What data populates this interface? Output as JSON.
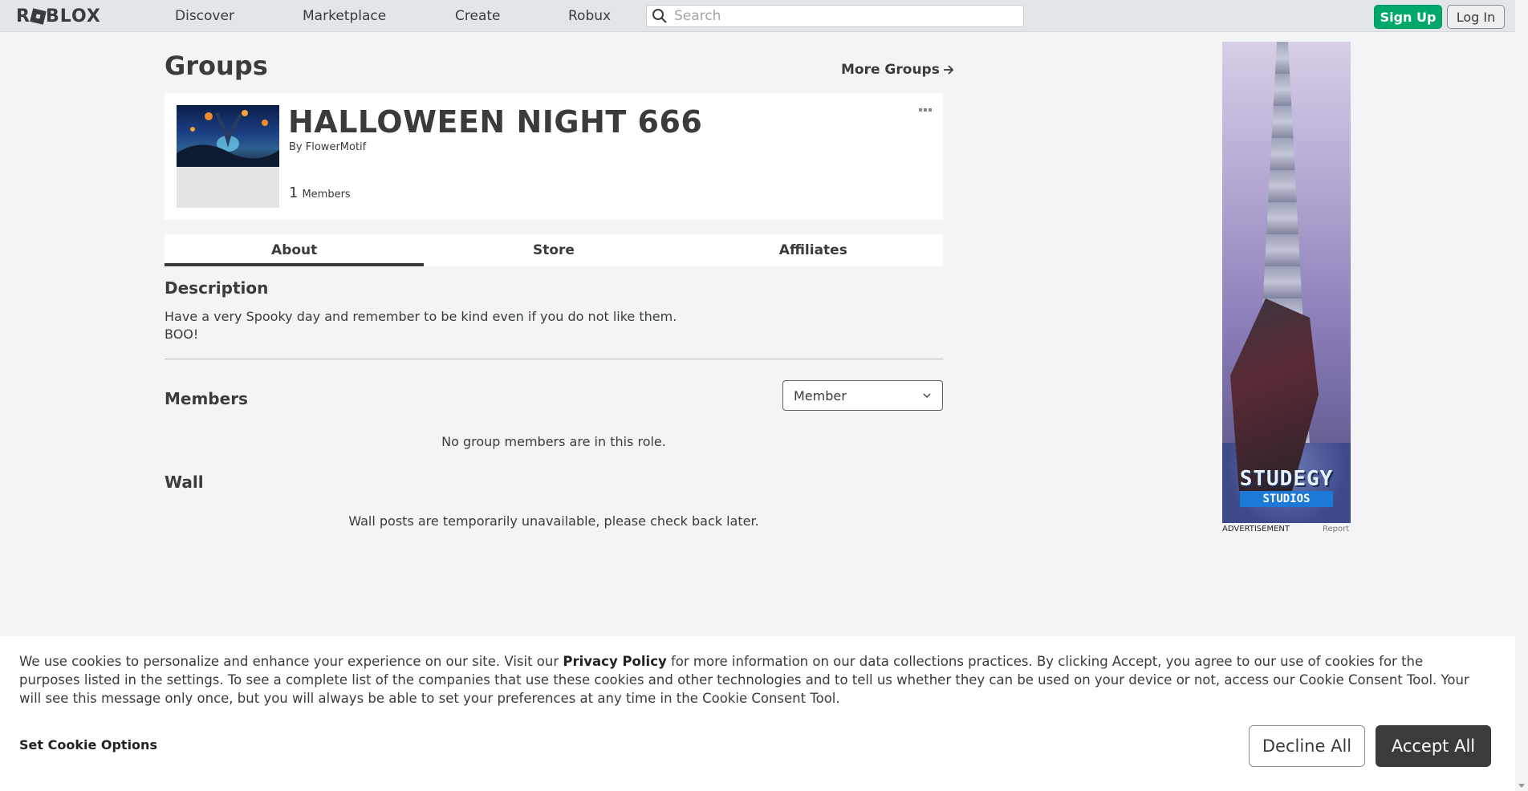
{
  "nav": {
    "logo": "ROBLOX",
    "links": [
      "Discover",
      "Marketplace",
      "Create",
      "Robux"
    ],
    "search_placeholder": "Search",
    "sign_up": "Sign Up",
    "log_in": "Log In"
  },
  "page": {
    "title": "Groups",
    "more_groups": "More Groups"
  },
  "group": {
    "name": "HALLOWEEN NIGHT 666",
    "by_label": "By",
    "owner": "FlowerMotif",
    "member_count": "1",
    "members_label": "Members"
  },
  "tabs": [
    "About",
    "Store",
    "Affiliates"
  ],
  "about": {
    "description_heading": "Description",
    "description": "Have a very Spooky day and remember to be kind even if you do not like them.\nBOO!",
    "members_heading": "Members",
    "role_selected": "Member",
    "members_empty": "No group members are in this role.",
    "wall_heading": "Wall",
    "wall_unavailable": "Wall posts are temporarily unavailable, please check back later."
  },
  "ad": {
    "brand_line1": "STUDEGY",
    "brand_line2": "STUDIOS",
    "label": "ADVERTISEMENT",
    "report": "Report"
  },
  "cookie": {
    "text_before": "We use cookies to personalize and enhance your experience on our site. Visit our ",
    "privacy_link": "Privacy Policy",
    "text_after": " for more information on our data collections practices. By clicking Accept, you agree to our use of cookies for the purposes listed in the settings. To see a complete list of the companies that use these cookies and other technologies and to tell us whether they can be used on your device or not, access our Cookie Consent Tool. Your will see this message only once, but you will always be able to set your preferences at any time in the Cookie Consent Tool.",
    "set_options": "Set Cookie Options",
    "decline": "Decline All",
    "accept": "Accept All"
  },
  "colors": {
    "accent_green": "#00a86b",
    "text_dark": "#393b3d",
    "background": "#f2f4f5"
  }
}
